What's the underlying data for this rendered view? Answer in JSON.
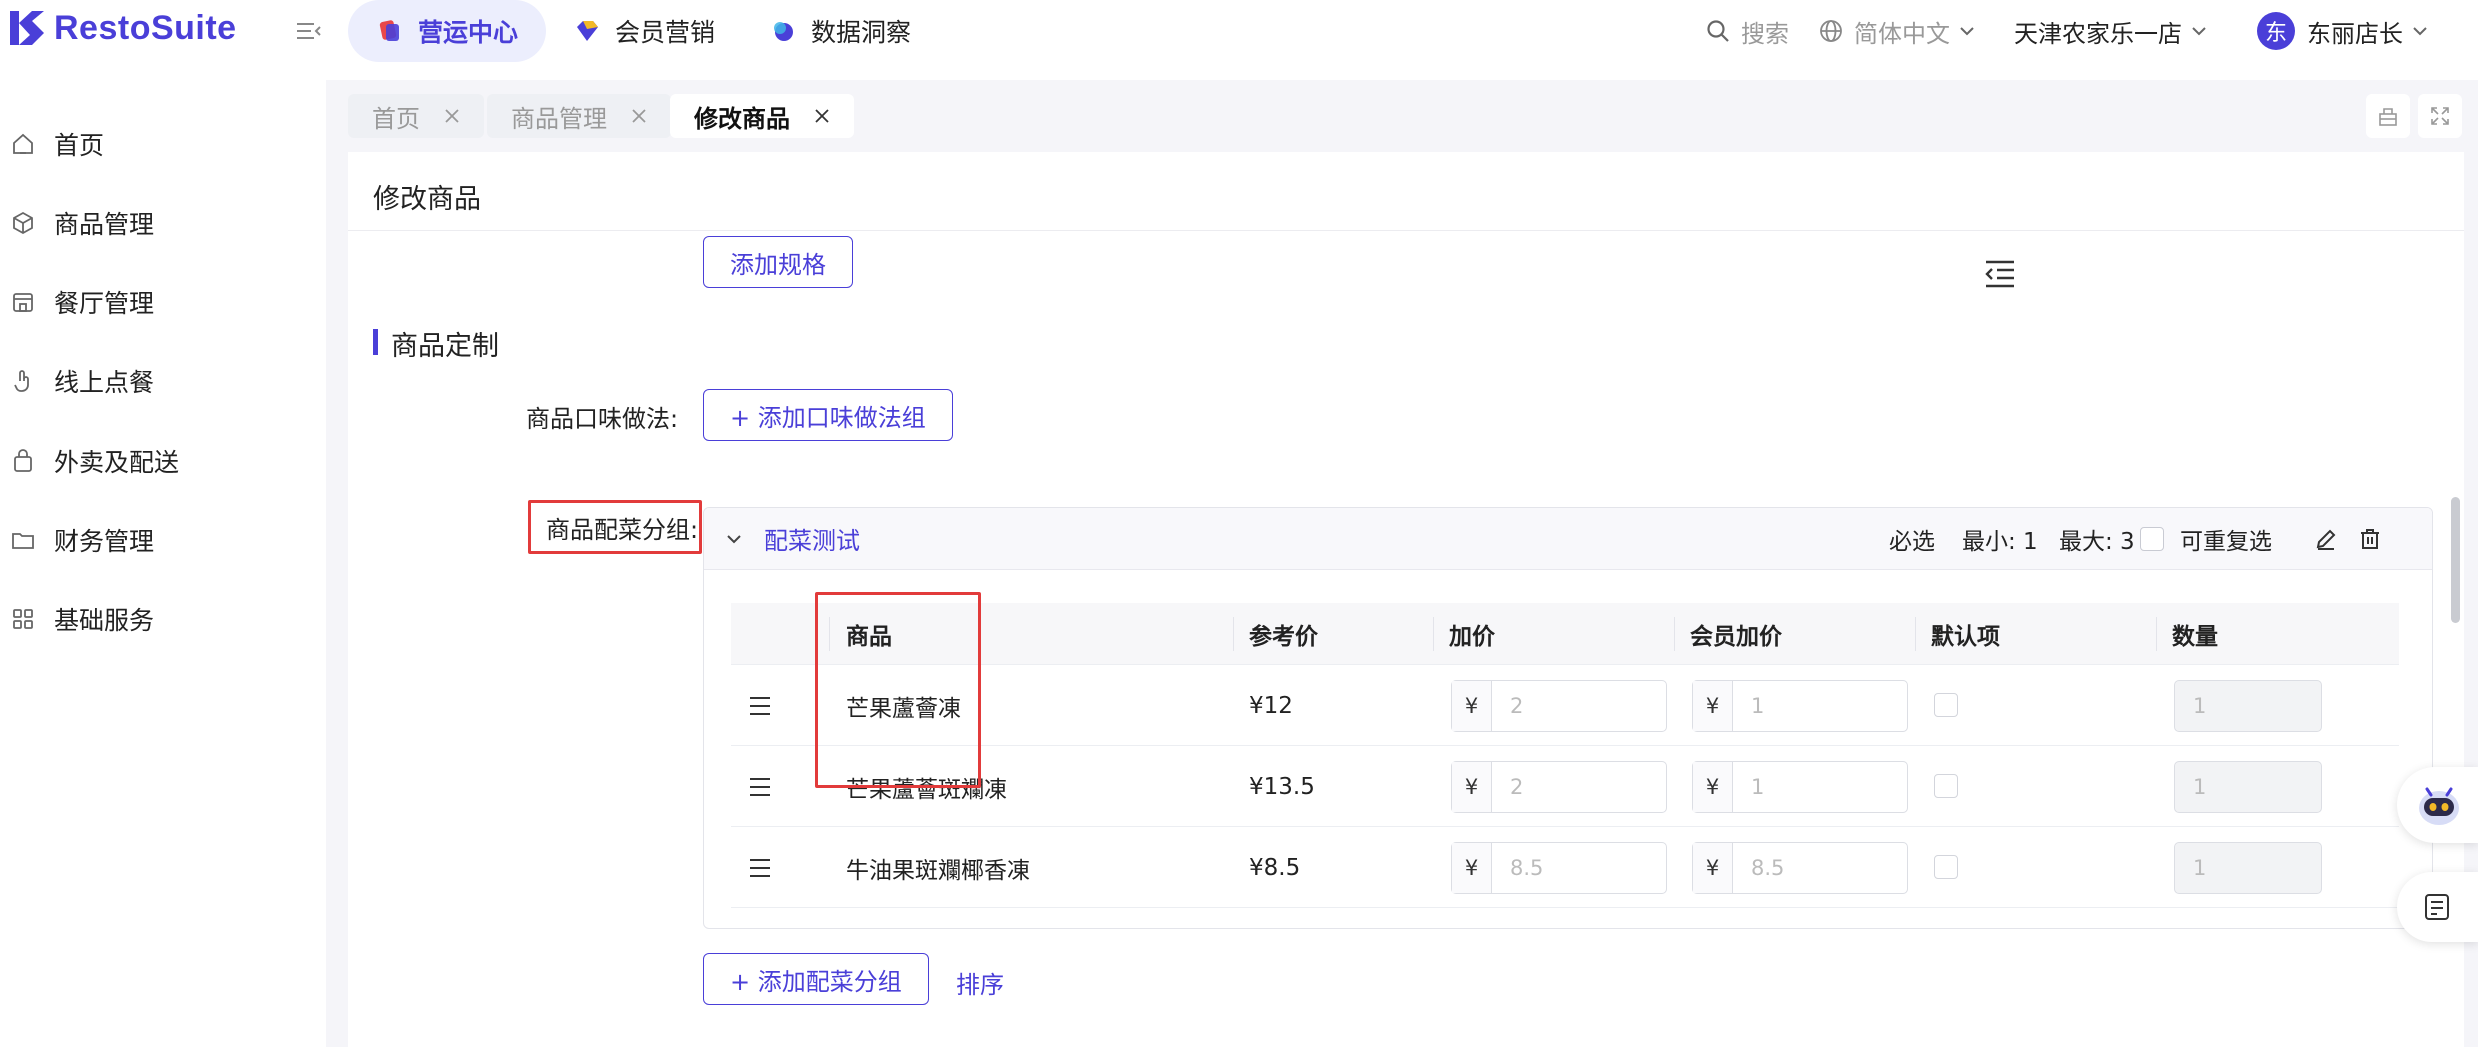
{
  "brand": {
    "name": "RestoSuite",
    "color": "#4a3fd8"
  },
  "module_tabs": [
    {
      "label": "营运中心",
      "icon": "cube-icon",
      "active": true
    },
    {
      "label": "会员营销",
      "icon": "diamond-icon",
      "active": false
    },
    {
      "label": "数据洞察",
      "icon": "orb-icon",
      "active": false
    }
  ],
  "header": {
    "search_label": "搜索",
    "language": "简体中文",
    "store": "天津农家乐一店",
    "avatar_letter": "东",
    "user": "东丽店长"
  },
  "sidebar": {
    "items": [
      {
        "label": "首页",
        "icon": "home-icon"
      },
      {
        "label": "商品管理",
        "icon": "box-icon"
      },
      {
        "label": "餐厅管理",
        "icon": "store-icon"
      },
      {
        "label": "线上点餐",
        "icon": "tap-icon"
      },
      {
        "label": "外卖及配送",
        "icon": "bag-icon"
      },
      {
        "label": "财务管理",
        "icon": "folder-icon"
      },
      {
        "label": "基础服务",
        "icon": "grid-icon"
      }
    ]
  },
  "page_tabs": [
    {
      "label": "首页",
      "active": false
    },
    {
      "label": "商品管理",
      "active": false
    },
    {
      "label": "修改商品",
      "active": true
    }
  ],
  "card": {
    "title": "修改商品",
    "add_spec_button": "添加规格",
    "section_title": "商品定制",
    "flavor_label": "商品口味做法:",
    "add_flavor_button": "+ 添加口味做法组",
    "side_group_label": "商品配菜分组:",
    "add_side_group_button": "+ 添加配菜分组",
    "sort_link": "排序"
  },
  "side_group": {
    "name": "配菜测试",
    "required": "必选",
    "min": "最小: 1",
    "max": "最大: 3",
    "repeatable_label": "可重复选",
    "columns": [
      "商品",
      "参考价",
      "加价",
      "会员加价",
      "默认项",
      "数量"
    ],
    "currency_symbol": "¥",
    "rows": [
      {
        "name": "芒果蘆薈凍",
        "ref_price": "¥12",
        "markup": "2",
        "member_markup": "1",
        "quantity": "1"
      },
      {
        "name": "芒果蘆薈斑斕凍",
        "ref_price": "¥13.5",
        "markup": "2",
        "member_markup": "1",
        "quantity": "1"
      },
      {
        "name": "牛油果斑斕椰香凍",
        "ref_price": "¥8.5",
        "markup": "8.5",
        "member_markup": "8.5",
        "quantity": "1"
      }
    ]
  }
}
